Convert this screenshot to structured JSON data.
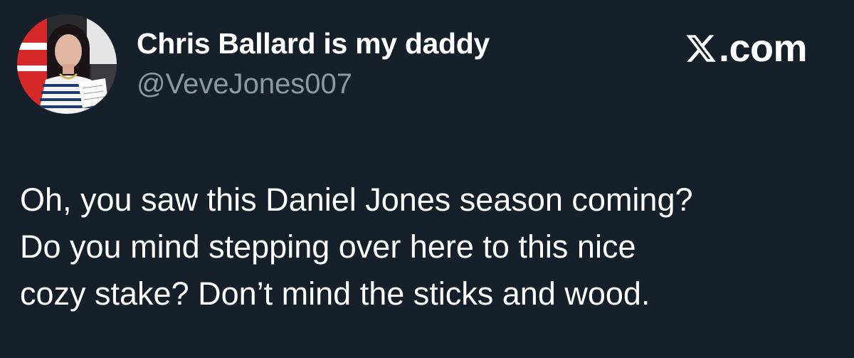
{
  "author": {
    "display_name": "Chris Ballard is my daddy",
    "handle": "@VeveJones007"
  },
  "brand": {
    "label": ".com",
    "icon": "x-logo-icon"
  },
  "tweet": {
    "lines": [
      "Oh, you saw this Daniel Jones season coming?",
      "Do you mind stepping over here to this nice",
      "cozy stake? Don’t mind the sticks and wood."
    ]
  },
  "colors": {
    "background": "#16202b",
    "text_primary": "#ffffff",
    "text_secondary": "#8b98a5"
  }
}
